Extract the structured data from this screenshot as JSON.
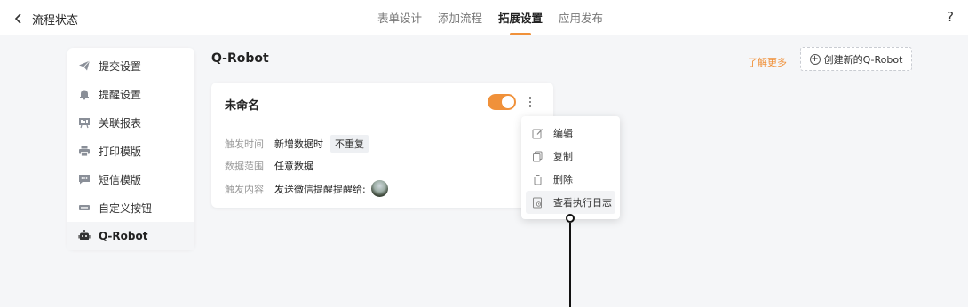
{
  "header": {
    "back_title": "流程状态",
    "tabs": [
      {
        "label": "表单设计",
        "active": false
      },
      {
        "label": "添加流程",
        "active": false
      },
      {
        "label": "拓展设置",
        "active": true
      },
      {
        "label": "应用发布",
        "active": false
      }
    ],
    "help_label": "?"
  },
  "sidebar": {
    "items": [
      {
        "label": "提交设置",
        "icon": "paper-plane-icon",
        "active": false
      },
      {
        "label": "提醒设置",
        "icon": "bell-icon",
        "active": false
      },
      {
        "label": "关联报表",
        "icon": "report-icon",
        "active": false
      },
      {
        "label": "打印模版",
        "icon": "printer-icon",
        "active": false
      },
      {
        "label": "短信模版",
        "icon": "message-icon",
        "active": false
      },
      {
        "label": "自定义按钮",
        "icon": "custom-button-icon",
        "active": false
      },
      {
        "label": "Q-Robot",
        "icon": "robot-icon",
        "active": true
      }
    ]
  },
  "main": {
    "title": "Q-Robot",
    "learn_more": "了解更多",
    "create_label": "创建新的Q-Robot"
  },
  "card": {
    "name": "未命名",
    "enabled": true,
    "trigger_time_label": "触发时间",
    "trigger_time_value": "新增数据时",
    "trigger_time_tag": "不重复",
    "data_range_label": "数据范围",
    "data_range_value": "任意数据",
    "trigger_content_label": "触发内容",
    "trigger_content_value": "发送微信提醒提醒给:"
  },
  "menu": {
    "items": [
      {
        "label": "编辑",
        "icon": "edit-icon"
      },
      {
        "label": "复制",
        "icon": "copy-icon"
      },
      {
        "label": "删除",
        "icon": "trash-icon"
      },
      {
        "label": "查看执行日志",
        "icon": "log-icon"
      }
    ]
  },
  "colors": {
    "accent": "#f0913a",
    "background": "#f5f6f8"
  }
}
